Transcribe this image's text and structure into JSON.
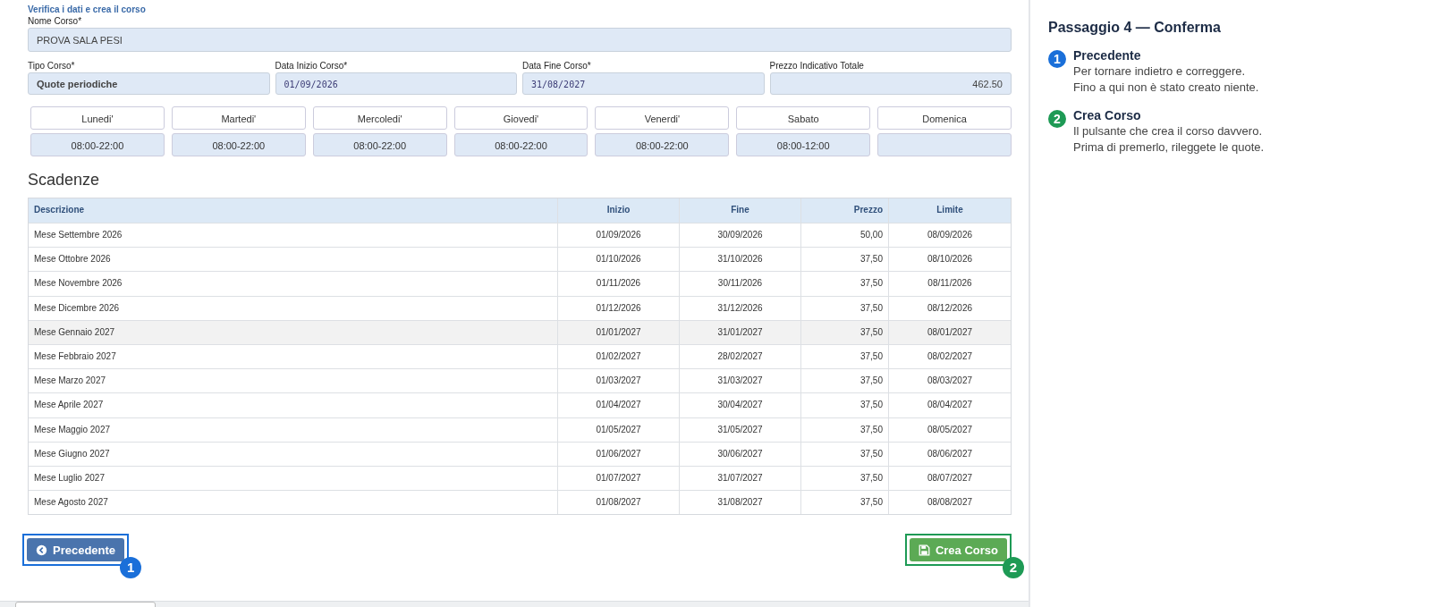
{
  "form": {
    "title": "Verifica i dati e crea il corso",
    "name_field": {
      "label": "Nome Corso*",
      "value": "PROVA SALA PESI"
    },
    "fields": [
      {
        "label": "Tipo Corso*",
        "value": "Quote periodiche",
        "kind": "select"
      },
      {
        "label": "Data Inizio Corso*",
        "value": "01/09/2026",
        "kind": "date"
      },
      {
        "label": "Data Fine Corso*",
        "value": "31/08/2027",
        "kind": "date"
      },
      {
        "label": "Prezzo Indicativo Totale",
        "value": "462.50",
        "kind": "number"
      }
    ],
    "days": [
      {
        "day": "Lunedi'",
        "hours": "08:00-22:00"
      },
      {
        "day": "Martedi'",
        "hours": "08:00-22:00"
      },
      {
        "day": "Mercoledi'",
        "hours": "08:00-22:00"
      },
      {
        "day": "Giovedi'",
        "hours": "08:00-22:00"
      },
      {
        "day": "Venerdi'",
        "hours": "08:00-22:00"
      },
      {
        "day": "Sabato",
        "hours": "08:00-12:00"
      },
      {
        "day": "Domenica"
      }
    ]
  },
  "scadenze": {
    "title": "Scadenze",
    "columns": [
      "Descrizione",
      "Inizio",
      "Fine",
      "Prezzo",
      "Limite"
    ],
    "rows": [
      {
        "cells": [
          "Mese Settembre 2026",
          "01/09/2026",
          "30/09/2026",
          "50,00",
          "08/09/2026"
        ],
        "hovered": false
      },
      {
        "cells": [
          "Mese Ottobre 2026",
          "01/10/2026",
          "31/10/2026",
          "37,50",
          "08/10/2026"
        ],
        "hovered": false
      },
      {
        "cells": [
          "Mese Novembre 2026",
          "01/11/2026",
          "30/11/2026",
          "37,50",
          "08/11/2026"
        ],
        "hovered": false
      },
      {
        "cells": [
          "Mese Dicembre 2026",
          "01/12/2026",
          "31/12/2026",
          "37,50",
          "08/12/2026"
        ],
        "hovered": false
      },
      {
        "cells": [
          "Mese Gennaio 2027",
          "01/01/2027",
          "31/01/2027",
          "37,50",
          "08/01/2027"
        ],
        "hovered": true
      },
      {
        "cells": [
          "Mese Febbraio 2027",
          "01/02/2027",
          "28/02/2027",
          "37,50",
          "08/02/2027"
        ],
        "hovered": false
      },
      {
        "cells": [
          "Mese Marzo 2027",
          "01/03/2027",
          "31/03/2027",
          "37,50",
          "08/03/2027"
        ],
        "hovered": false
      },
      {
        "cells": [
          "Mese Aprile 2027",
          "01/04/2027",
          "30/04/2027",
          "37,50",
          "08/04/2027"
        ],
        "hovered": false
      },
      {
        "cells": [
          "Mese Maggio 2027",
          "01/05/2027",
          "31/05/2027",
          "37,50",
          "08/05/2027"
        ],
        "hovered": false
      },
      {
        "cells": [
          "Mese Giugno 2027",
          "01/06/2027",
          "30/06/2027",
          "37,50",
          "08/06/2027"
        ],
        "hovered": false
      },
      {
        "cells": [
          "Mese Luglio 2027",
          "01/07/2027",
          "31/07/2027",
          "37,50",
          "08/07/2027"
        ],
        "hovered": false
      },
      {
        "cells": [
          "Mese Agosto 2027",
          "01/08/2027",
          "31/08/2027",
          "37,50",
          "08/08/2027"
        ],
        "hovered": false
      }
    ]
  },
  "buttons": [
    {
      "label": "Precedente",
      "kind": "back",
      "badge": "1",
      "color": "#1a6fd9"
    },
    {
      "label": "Crea Corso",
      "kind": "save",
      "badge": "2",
      "color": "#1e9a55"
    }
  ],
  "guide": {
    "title": "Passaggio 4 — Conferma",
    "steps": [
      {
        "badge": "1",
        "color": "#1a6fd9",
        "title": "Precedente",
        "lines": [
          "Per tornare indietro e correggere.",
          "Fino a qui non è stato creato niente."
        ]
      },
      {
        "badge": "2",
        "color": "#1e9a55",
        "title": "Crea Corso",
        "lines": [
          "Il pulsante che crea il corso davvero.",
          "Prima di premerlo, rileggete le quote."
        ]
      }
    ]
  }
}
